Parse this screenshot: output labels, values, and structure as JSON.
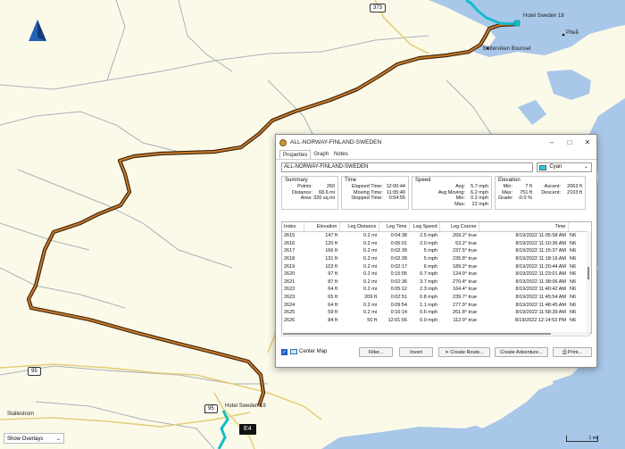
{
  "map": {
    "places": {
      "hotel_top": "Hotel Sweden 18",
      "pitea": "Piteå",
      "battervik": "Bätterviken Bounset",
      "hotel_bottom": "Hotel Sweden 19",
      "road_bottom_left": "Stallestrom"
    },
    "roads": {
      "r373": "373",
      "r95_left": "95",
      "r95_bottom": "95",
      "e4": "E4"
    },
    "overlay_select": "Show Overlays",
    "scale_label": "1 mi",
    "colors": {
      "water": "#a9c7e8",
      "land": "#fbfae9",
      "track": "#8a4a16",
      "road_major": "#e8d080"
    }
  },
  "dialog": {
    "title": "ALL-NORWAY-FINLAND-SWEDEN",
    "tabs": [
      "Properties",
      "Graph",
      "Notes"
    ],
    "name_value": "ALL-NORWAY-FINLAND-SWEDEN",
    "color": {
      "label": "Cyan",
      "hex": "#1ed3e0"
    },
    "summary": {
      "label": "Summary",
      "rows": [
        {
          "k": "Points:",
          "v": "260"
        },
        {
          "k": "Distance:",
          "v": "68.6 mi"
        },
        {
          "k": "Area:",
          "v": "320 sq mi"
        }
      ]
    },
    "time": {
      "label": "Time",
      "rows": [
        {
          "k": "Elapsed Time:",
          "v": "12:00:44"
        },
        {
          "k": "Moving Time:",
          "v": "11:05:49"
        },
        {
          "k": "Stopped Time:",
          "v": "0:54:55"
        }
      ]
    },
    "speed": {
      "label": "Speed",
      "rows": [
        {
          "k": "Avg:",
          "v": "5.7 mph"
        },
        {
          "k": "Avg Moving:",
          "v": "6.2 mph"
        },
        {
          "k": "Min:",
          "v": "0.2 mph"
        },
        {
          "k": "Max:",
          "v": "22 mph"
        }
      ]
    },
    "elevation": {
      "label": "Elevation",
      "rows": [
        {
          "k": "Min:",
          "v": "7 ft",
          "k2": "Ascent:",
          "v2": "2063 ft"
        },
        {
          "k": "Max:",
          "v": "751 ft",
          "k2": "Descent:",
          "v2": "2103 ft"
        },
        {
          "k": "Grade:",
          "v": "-0.0 %",
          "k2": "",
          "v2": ""
        }
      ]
    },
    "table": {
      "headers": [
        "Index",
        "Elevation",
        "Leg Distance",
        "Leg Time",
        "Leg Speed",
        "Leg Course",
        "Time",
        ""
      ],
      "rows": [
        [
          "2615",
          "147 ft",
          "0.2 mi",
          "0:04:38",
          "2.5 mph",
          "269.2° true",
          "8/19/2022 11:05:58 AM",
          "N6"
        ],
        [
          "2616",
          "120 ft",
          "0.2 mi",
          "0:05:01",
          "2.0 mph",
          "53.2° true",
          "8/19/2022 11:10:36 AM",
          "N6"
        ],
        [
          "2617",
          "166 ft",
          "0.2 mi",
          "0:02:39",
          "5 mph",
          "237.5° true",
          "8/19/2022 11:15:37 AM",
          "N6"
        ],
        [
          "2618",
          "131 ft",
          "0.2 mi",
          "0:02:28",
          "5 mph",
          "235.8° true",
          "8/19/2022 11:18:16 AM",
          "N6"
        ],
        [
          "2619",
          "103 ft",
          "0.2 mi",
          "0:02:17",
          "6 mph",
          "189.2° true",
          "8/19/2022 11:20:44 AM",
          "N6"
        ],
        [
          "2620",
          "97 ft",
          "0.2 mi",
          "0:15:05",
          "0.7 mph",
          "124.9° true",
          "8/19/2022 11:23:01 AM",
          "N6"
        ],
        [
          "2621",
          "87 ft",
          "0.2 mi",
          "0:02:36",
          "3.7 mph",
          "270.4° true",
          "8/19/2022 11:38:06 AM",
          "N6"
        ],
        [
          "2622",
          "64 ft",
          "0.2 mi",
          "0:05:12",
          "2.3 mph",
          "164.4° true",
          "8/19/2022 11:40:42 AM",
          "N6"
        ],
        [
          "2623",
          "65 ft",
          "209 ft",
          "0:02:51",
          "0.8 mph",
          "239.7° true",
          "8/19/2022 11:45:54 AM",
          "N6"
        ],
        [
          "2624",
          "64 ft",
          "0.2 mi",
          "0:09:54",
          "1.1 mph",
          "277.9° true",
          "8/19/2022 11:48:45 AM",
          "N6"
        ],
        [
          "2625",
          "59 ft",
          "0.2 mi",
          "0:16:14",
          "0.6 mph",
          "261.8° true",
          "8/19/2022 11:58:39 AM",
          "N6"
        ],
        [
          "2626",
          "84 ft",
          "50 ft",
          "12:01:56",
          "0.0 mph",
          "112.0° true",
          "8/19/2022 12:14:53 PM",
          "N6"
        ]
      ]
    },
    "center_map_label": "Center Map",
    "buttons": {
      "filter": "Filter...",
      "invert": "Invert",
      "create_route": "Create Route...",
      "create_adventure": "Create Adventure...",
      "print": "Print..."
    }
  }
}
